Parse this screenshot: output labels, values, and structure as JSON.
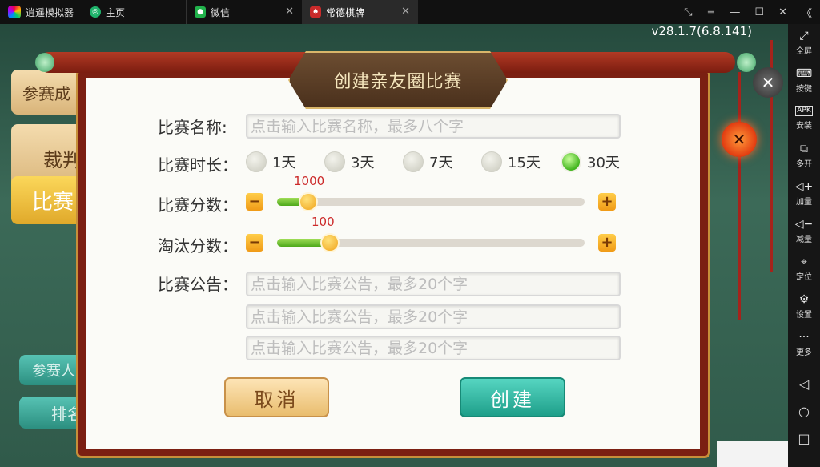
{
  "window": {
    "app_name": "逍遥模拟器",
    "tabs": [
      {
        "label": "主页"
      },
      {
        "label": "微信"
      },
      {
        "label": "常德棋牌"
      }
    ],
    "controls": [
      "⤡",
      "≡",
      "—",
      "☐",
      "✕",
      "《"
    ]
  },
  "game": {
    "version": "v28.1.7(6.8.141)",
    "background_buttons": [
      "参赛成",
      "裁判",
      "比赛",
      "参赛人",
      "排名"
    ]
  },
  "dialog": {
    "title": "创建亲友圈比赛",
    "name_label": "比赛名称:",
    "name_placeholder": "点击输入比赛名称，最多八个字",
    "duration_label": "比赛时长：",
    "duration_options": [
      "1天",
      "3天",
      "7天",
      "15天",
      "30天"
    ],
    "duration_selected": "30天",
    "score_label": "比赛分数：",
    "score_value": "1000",
    "score_level": 0.07,
    "elim_label": "淘汰分数：",
    "elim_value": "100",
    "elim_level": 0.14,
    "notice_label": "比赛公告：",
    "notice_placeholder": "点击输入比赛公告，最多20个字",
    "cancel_label": "取消",
    "create_label": "创建",
    "minus_label": "−",
    "plus_label": "+"
  },
  "sidebar": {
    "items": [
      {
        "label": "全屏",
        "icon": "fullscreen-icon"
      },
      {
        "label": "按键",
        "icon": "keyboard-icon"
      },
      {
        "label": "安装",
        "icon": "apk-icon"
      },
      {
        "label": "多开",
        "icon": "multi-instance-icon"
      },
      {
        "label": "加量",
        "icon": "volume-up-icon"
      },
      {
        "label": "减量",
        "icon": "volume-down-icon"
      },
      {
        "label": "定位",
        "icon": "location-icon"
      },
      {
        "label": "设置",
        "icon": "gear-icon"
      },
      {
        "label": "更多",
        "icon": "more-icon"
      }
    ]
  },
  "colors": {
    "accent_green": "#4ea91b",
    "frame_red": "#7b1f12",
    "create_teal": "#1e9f8a",
    "cancel_gold": "#e9bd6e",
    "slider_value_red": "#cc2a2a"
  }
}
